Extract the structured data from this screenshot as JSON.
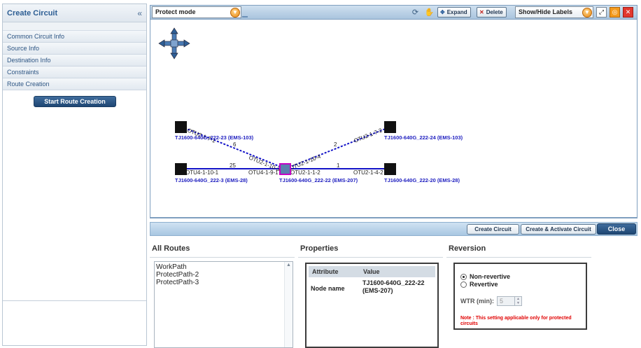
{
  "colors": {
    "accent": "#1e4673",
    "node": "#111111",
    "selected_node_fill": "#5b7fb0",
    "selected_node_border": "#c400c4",
    "work_link": "#1414c8",
    "protect_link": "#1414c8",
    "note": "#e00000"
  },
  "left_panel": {
    "title": "Create Circuit",
    "collapse_glyph": "«",
    "sections": [
      "Common Circuit Info",
      "Source Info",
      "Destination Info",
      "Constraints",
      "Route Creation"
    ],
    "start_button": "Start Route Creation"
  },
  "toolbar": {
    "mode": "Protect mode",
    "mode_icon": "chevron-down-icon",
    "refresh_icon": "refresh-icon",
    "pan_icon": "hand-icon",
    "expand": "Expand",
    "delete": "Delete",
    "labels": "Show/Hide Labels",
    "labels_icon": "chevron-down-icon",
    "fit_icon": "fit-view-icon",
    "zoom_icon": "zoom-icon",
    "close_icon": "close-icon"
  },
  "canvas": {
    "nav_control": "pan-arrows-icon",
    "nodes": [
      {
        "id": "n23",
        "label": "TJ1600-640G_222-23 (EMS-103)"
      },
      {
        "id": "n24",
        "label": "TJ1600-640G_222-24 (EMS-103)"
      },
      {
        "id": "n3",
        "label": "TJ1600-640G_222-3 (EMS-28)"
      },
      {
        "id": "n22",
        "label": "TJ1600-640G_222-22 (EMS-207)",
        "selected": true
      },
      {
        "id": "n20",
        "label": "TJ1600-640G_222-20 (EMS-28)"
      }
    ],
    "links": [
      {
        "from": "n3",
        "to": "n22",
        "style": "solid",
        "weight": "25",
        "src_port": "OTU4-1-10-1",
        "dst_port": "OTU4-1-9-1"
      },
      {
        "from": "n22",
        "to": "n20",
        "style": "solid",
        "weight": "1",
        "src_port": "OTU2-1-1-2",
        "dst_port": "OTU2-1-4-2"
      },
      {
        "from": "n23",
        "to": "n22",
        "style": "dashed",
        "weight": "6",
        "src_port": "OTU2-1-7-1",
        "dst_port": "OTU2-1-10-3"
      },
      {
        "from": "n22",
        "to": "n24",
        "style": "dashed",
        "weight": "2",
        "src_port": "OTU2-1-10-4",
        "dst_port": "OTU2-1-7-2"
      }
    ]
  },
  "actions": {
    "create": "Create Circuit",
    "create_activate": "Create & Activate Circuit",
    "close": "Close"
  },
  "all_routes": {
    "title": "All Routes",
    "items": [
      "WorkPath",
      "ProtectPath-2",
      "ProtectPath-3"
    ]
  },
  "properties": {
    "title": "Properties",
    "col_attribute": "Attribute",
    "col_value": "Value",
    "rows": [
      {
        "attribute": "Node name",
        "value_line1": "TJ1600-640G_222-22",
        "value_line2": "(EMS-207)"
      }
    ]
  },
  "reversion": {
    "title": "Reversion",
    "non_revertive": "Non-revertive",
    "revertive": "Revertive",
    "selected": "Non-revertive",
    "wtr_label": "WTR (min):",
    "wtr_value": "5",
    "note": "Note : This setting applicable only for protected circuits"
  }
}
